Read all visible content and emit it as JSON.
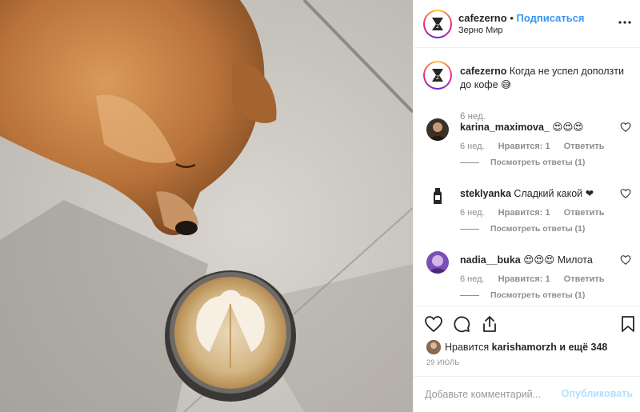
{
  "post": {
    "username": "cafezerno",
    "separator": "•",
    "follow_label": "Подписаться",
    "location": "Зерно Мир"
  },
  "caption": {
    "username": "cafezerno",
    "text": "Когда не успел доползти до кофе 😅",
    "time": "6 нед."
  },
  "comments": [
    {
      "username": "karina_maximova_",
      "text": "😍😍😍",
      "time": "6 нед.",
      "likes": "Нравится: 1",
      "reply": "Ответить",
      "view_replies": "Посмотреть ответы (1)"
    },
    {
      "username": "steklyanka",
      "text": "Сладкий какой ❤",
      "time": "6 нед.",
      "likes": "Нравится: 1",
      "reply": "Ответить",
      "view_replies": "Посмотреть ответы (1)"
    },
    {
      "username": "nadia__buka",
      "text": "😍😍😍 Милота",
      "time": "6 нед.",
      "likes": "Нравится: 1",
      "reply": "Ответить",
      "view_replies": "Посмотреть ответы (1)"
    }
  ],
  "likes": {
    "prefix": "Нравится",
    "user": "karishamorzh",
    "suffix": "и ещё 348"
  },
  "date": "29 ИЮЛЬ",
  "add_comment": {
    "placeholder": "Добавьте комментарий...",
    "post_label": "Опубликовать"
  },
  "colors": {
    "link": "#3897f0",
    "muted": "#8e8e8e",
    "post_disabled": "#b2dffc"
  },
  "icons": [
    "more-icon",
    "heart-icon",
    "comment-icon",
    "share-icon",
    "bookmark-icon"
  ]
}
